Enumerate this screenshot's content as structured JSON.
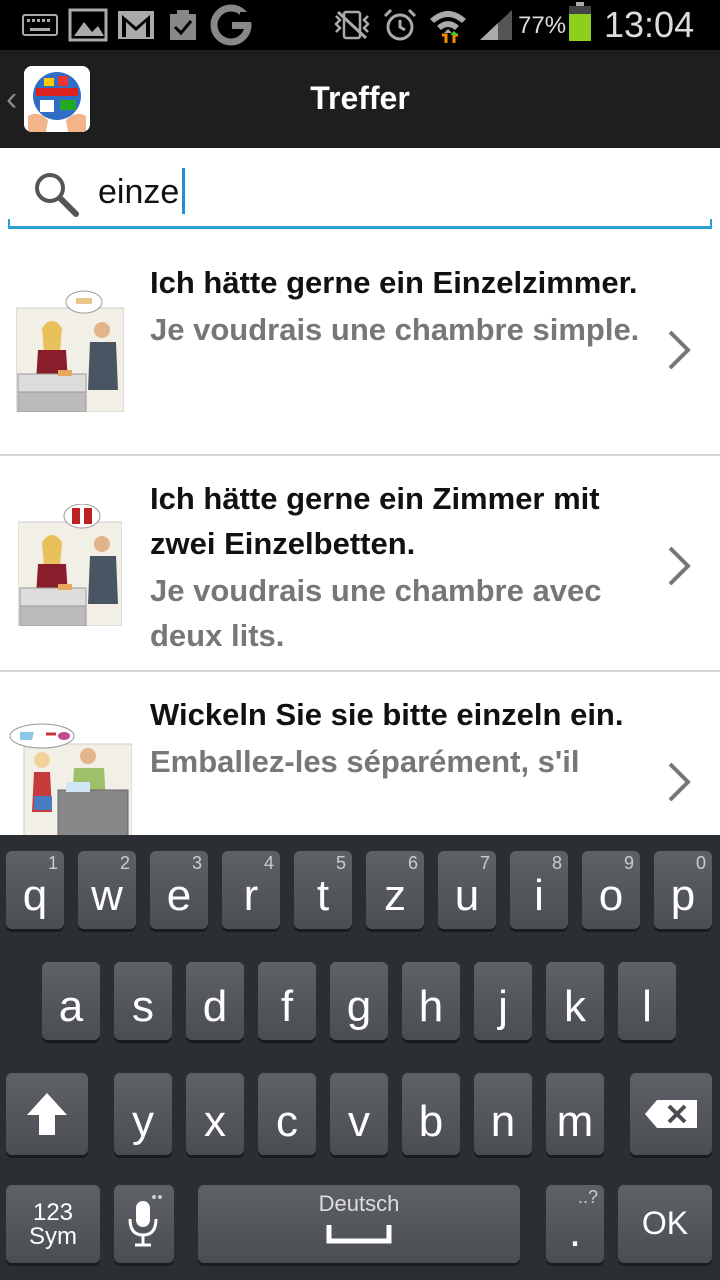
{
  "status_bar": {
    "battery_percent": "77%",
    "time": "13:04",
    "icons": [
      "keyboard-icon",
      "image-icon",
      "gmail-icon",
      "clipboard-check-icon",
      "google-icon",
      "vibrate-icon",
      "alarm-icon",
      "wifi-icon",
      "signal-icon",
      "battery-icon"
    ]
  },
  "action_bar": {
    "title": "Treffer"
  },
  "search": {
    "value": "einze"
  },
  "results": [
    {
      "german": "Ich hätte gerne ein Einzelzimmer.",
      "french": "Je voudrais une chambre simple."
    },
    {
      "german": "Ich hätte gerne ein Zimmer mit zwei Einzelbetten.",
      "french": "Je voudrais une chambre avec deux lits."
    },
    {
      "german": "Wickeln Sie sie bitte einzeln ein.",
      "french": "Emballez-les séparément, s'il"
    }
  ],
  "keyboard": {
    "row1": [
      {
        "key": "q",
        "num": "1"
      },
      {
        "key": "w",
        "num": "2"
      },
      {
        "key": "e",
        "num": "3"
      },
      {
        "key": "r",
        "num": "4"
      },
      {
        "key": "t",
        "num": "5"
      },
      {
        "key": "z",
        "num": "6"
      },
      {
        "key": "u",
        "num": "7"
      },
      {
        "key": "i",
        "num": "8"
      },
      {
        "key": "o",
        "num": "9"
      },
      {
        "key": "p",
        "num": "0"
      }
    ],
    "row2": [
      "a",
      "s",
      "d",
      "f",
      "g",
      "h",
      "j",
      "k",
      "l"
    ],
    "row3": [
      "y",
      "x",
      "c",
      "v",
      "b",
      "n",
      "m"
    ],
    "sym_line1": "123",
    "sym_line2": "Sym",
    "space_label": "Deutsch",
    "period_label": ".",
    "period_hint": "..?",
    "ok_label": "OK"
  }
}
